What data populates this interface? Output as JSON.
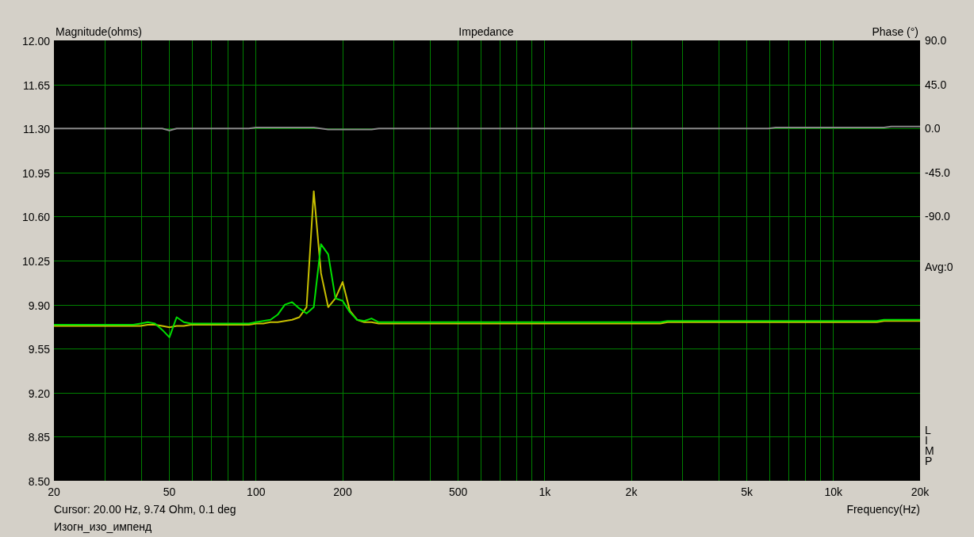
{
  "chart": {
    "brand_label": "LIMP",
    "avg_label": "Avg:0",
    "chart_data": {
      "type": "line",
      "title": "Impedance",
      "xlabel": "Frequency(Hz)",
      "ylabel": "Magnitude(ohms)",
      "y2label": "Phase (°)",
      "categories": [
        "20",
        null,
        null,
        null,
        null,
        null,
        null,
        null,
        null,
        null,
        null,
        null,
        null,
        null,
        null,
        null,
        "50",
        null,
        null,
        null,
        null,
        null,
        null,
        null,
        null,
        null,
        null,
        null,
        "100",
        null,
        null,
        null,
        null,
        null,
        null,
        null,
        null,
        null,
        null,
        null,
        "200",
        null,
        null,
        null,
        null,
        null,
        null,
        null,
        null,
        null,
        null,
        null,
        null,
        null,
        null,
        null,
        "500",
        null,
        null,
        null,
        null,
        null,
        null,
        null,
        null,
        null,
        null,
        null,
        "1k",
        null,
        null,
        null,
        null,
        null,
        null,
        null,
        null,
        null,
        null,
        null,
        "2k",
        null,
        null,
        null,
        null,
        null,
        null,
        null,
        null,
        null,
        null,
        null,
        null,
        null,
        null,
        null,
        "5k",
        null,
        null,
        null,
        null,
        null,
        null,
        null,
        null,
        null,
        null,
        null,
        "10k",
        null,
        null,
        null,
        null,
        null,
        null,
        null,
        null,
        null,
        null,
        null,
        "20k"
      ],
      "series": [
        {
          "color": "#c8c000",
          "values": [
            9.73,
            9.73,
            9.73,
            9.73,
            9.73,
            9.73,
            9.73,
            9.73,
            9.73,
            9.73,
            9.73,
            9.73,
            9.73,
            9.74,
            9.74,
            9.73,
            9.72,
            9.73,
            9.73,
            9.74,
            9.74,
            9.74,
            9.74,
            9.74,
            9.74,
            9.74,
            9.74,
            9.74,
            9.75,
            9.75,
            9.76,
            9.76,
            9.77,
            9.78,
            9.8,
            9.88,
            10.8,
            10.15,
            9.88,
            9.95,
            10.08,
            9.85,
            9.78,
            9.76,
            9.76,
            9.75,
            9.75,
            9.75,
            9.75,
            9.75,
            9.75,
            9.75,
            9.75,
            9.75,
            9.75,
            9.75,
            9.75,
            9.75,
            9.75,
            9.75,
            9.75,
            9.75,
            9.75,
            9.75,
            9.75,
            9.75,
            9.75,
            9.75,
            9.75,
            9.75,
            9.75,
            9.75,
            9.75,
            9.75,
            9.75,
            9.75,
            9.75,
            9.75,
            9.75,
            9.75,
            9.75,
            9.75,
            9.75,
            9.75,
            9.75,
            9.76,
            9.76,
            9.76,
            9.76,
            9.76,
            9.76,
            9.76,
            9.76,
            9.76,
            9.76,
            9.76,
            9.76,
            9.76,
            9.76,
            9.76,
            9.76,
            9.76,
            9.76,
            9.76,
            9.76,
            9.76,
            9.76,
            9.76,
            9.76,
            9.76,
            9.76,
            9.76,
            9.76,
            9.76,
            9.76,
            9.77,
            9.77,
            9.77,
            9.77,
            9.77,
            9.77
          ]
        },
        {
          "color": "#00e000",
          "values": [
            9.74,
            9.74,
            9.74,
            9.74,
            9.74,
            9.74,
            9.74,
            9.74,
            9.74,
            9.74,
            9.74,
            9.74,
            9.75,
            9.76,
            9.75,
            9.7,
            9.64,
            9.8,
            9.76,
            9.75,
            9.75,
            9.75,
            9.75,
            9.75,
            9.75,
            9.75,
            9.75,
            9.75,
            9.76,
            9.77,
            9.78,
            9.82,
            9.9,
            9.92,
            9.87,
            9.83,
            9.88,
            10.38,
            10.3,
            9.95,
            9.93,
            9.84,
            9.78,
            9.77,
            9.79,
            9.76,
            9.76,
            9.76,
            9.76,
            9.76,
            9.76,
            9.76,
            9.76,
            9.76,
            9.76,
            9.76,
            9.76,
            9.76,
            9.76,
            9.76,
            9.76,
            9.76,
            9.76,
            9.76,
            9.76,
            9.76,
            9.76,
            9.76,
            9.76,
            9.76,
            9.76,
            9.76,
            9.76,
            9.76,
            9.76,
            9.76,
            9.76,
            9.76,
            9.76,
            9.76,
            9.76,
            9.76,
            9.76,
            9.76,
            9.76,
            9.77,
            9.77,
            9.77,
            9.77,
            9.77,
            9.77,
            9.77,
            9.77,
            9.77,
            9.77,
            9.77,
            9.77,
            9.77,
            9.77,
            9.77,
            9.77,
            9.77,
            9.77,
            9.77,
            9.77,
            9.77,
            9.77,
            9.77,
            9.77,
            9.77,
            9.77,
            9.77,
            9.77,
            9.77,
            9.77,
            9.78,
            9.78,
            9.78,
            9.78,
            9.78,
            9.78
          ]
        },
        {
          "color": "#888888",
          "axis": "y2",
          "values": [
            0,
            0,
            0,
            0,
            0,
            0,
            0,
            0,
            0,
            0,
            0,
            0,
            0,
            0,
            0,
            0,
            -2,
            0,
            0,
            0,
            0,
            0,
            0,
            0,
            0,
            0,
            0,
            0,
            1,
            1,
            1,
            1,
            1,
            1,
            1,
            1,
            1,
            0,
            -1,
            -1,
            -1,
            -1,
            -1,
            -1,
            -1,
            0,
            0,
            0,
            0,
            0,
            0,
            0,
            0,
            0,
            0,
            0,
            0,
            0,
            0,
            0,
            0,
            0,
            0,
            0,
            0,
            0,
            0,
            0,
            0,
            0,
            0,
            0,
            0,
            0,
            0,
            0,
            0,
            0,
            0,
            0,
            0,
            0,
            0,
            0,
            0,
            0,
            0,
            0,
            0,
            0,
            0,
            0,
            0,
            0,
            0,
            0,
            0,
            0,
            0,
            0,
            1,
            1,
            1,
            1,
            1,
            1,
            1,
            1,
            1,
            1,
            1,
            1,
            1,
            1,
            1,
            1,
            2,
            2,
            2,
            2,
            2
          ]
        }
      ],
      "grid": true,
      "ylim": [
        8.5,
        12
      ],
      "y2lim": [
        -360,
        90
      ],
      "yticks": [
        {
          "value": 12,
          "label": "12.00"
        },
        {
          "value": 11.65,
          "label": "11.65"
        },
        {
          "value": 11.3,
          "label": "11.30"
        },
        {
          "value": 10.95,
          "label": "10.95"
        },
        {
          "value": 10.6,
          "label": "10.60"
        },
        {
          "value": 10.25,
          "label": "10.25"
        },
        {
          "value": 9.9,
          "label": "9.90"
        },
        {
          "value": 9.55,
          "label": "9.55"
        },
        {
          "value": 9.2,
          "label": "9.20"
        },
        {
          "value": 8.85,
          "label": "8.85"
        },
        {
          "value": 8.5,
          "label": "8.50"
        }
      ],
      "y2ticks": [
        {
          "value": 90,
          "label": "90.0"
        },
        {
          "value": 45,
          "label": "45.0"
        },
        {
          "value": 0,
          "label": "0.0"
        },
        {
          "value": -45,
          "label": "-45.0"
        },
        {
          "value": -90,
          "label": "-90.0"
        }
      ]
    }
  },
  "status": {
    "cursor": "Cursor: 20.00 Hz, 9.74 Ohm, 0.1 deg",
    "file_name": "Изогн_изо_импенд"
  }
}
